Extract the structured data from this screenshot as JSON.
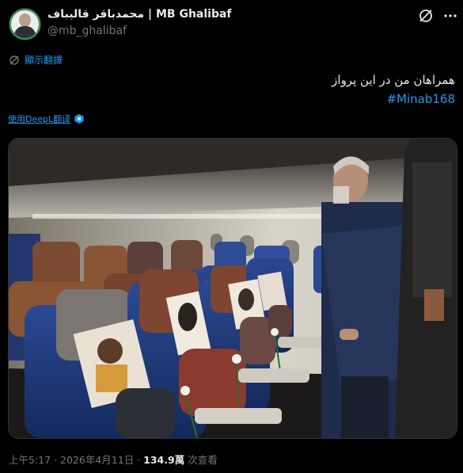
{
  "author": {
    "name": "محمدباقر قالیباف | MB Ghalibaf",
    "handle": "@mb_ghalibaf"
  },
  "translate_label": "顯示翻譯",
  "post": {
    "text": "همراهان من در این پرواز",
    "hashtag": "#Minab168"
  },
  "deepl_label": "使用DeepL翻译",
  "meta": {
    "time": "上午5:17",
    "separator": "·",
    "date": "2026年4月11日",
    "views": "134.9萬",
    "views_label": "次查看"
  },
  "icons": {
    "grok": "grok-icon",
    "more": "more-icon",
    "translate": "globe-icon",
    "deepl": "deepl-icon"
  },
  "colors": {
    "accent": "#1d9bf0",
    "background": "#000000",
    "secondary_text": "#71767b"
  }
}
